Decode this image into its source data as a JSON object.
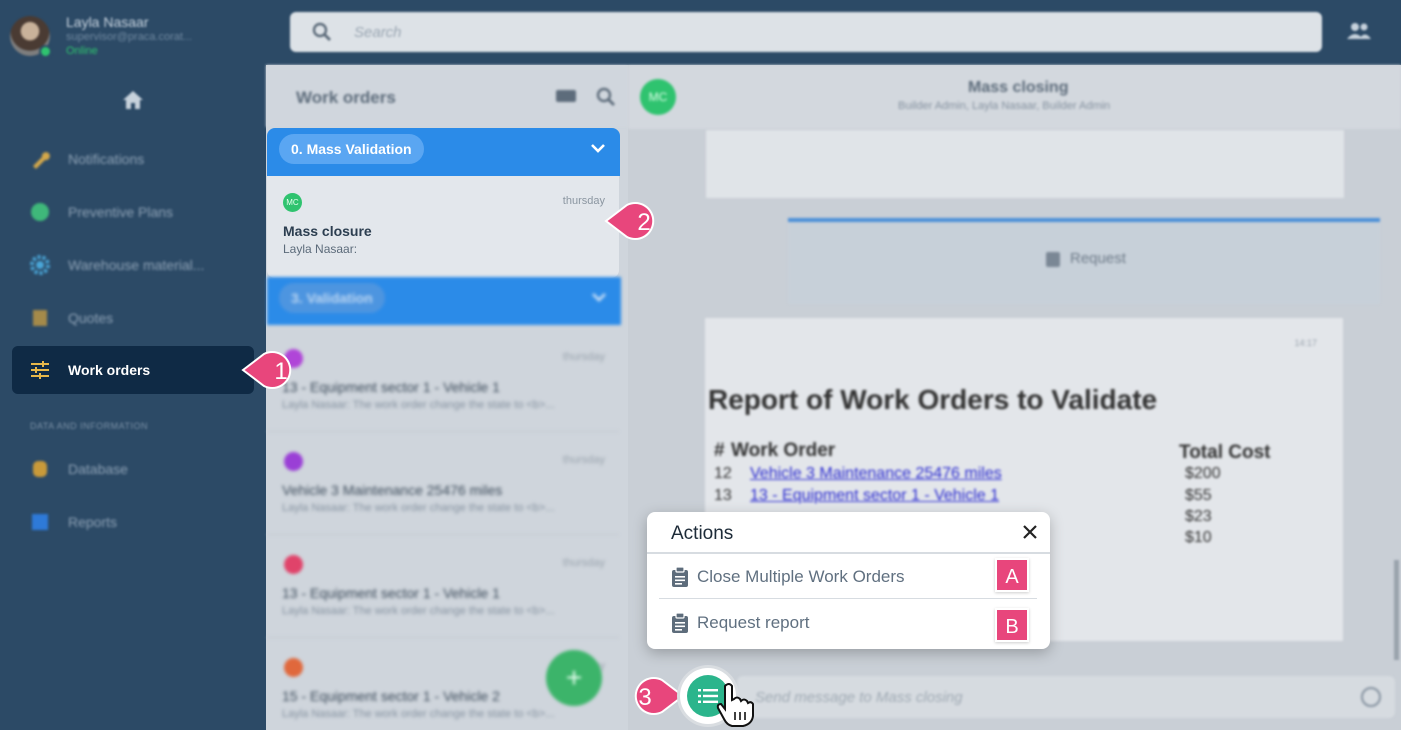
{
  "user": {
    "name": "Layla Nasaar",
    "email": "supervisor@praca.corat...",
    "status": "Online"
  },
  "search": {
    "placeholder": "Search"
  },
  "sidebar": {
    "items": [
      {
        "label": "Notifications",
        "icon": "wrench-icon"
      },
      {
        "label": "Preventive Plans",
        "icon": "globe-icon"
      },
      {
        "label": "Warehouse material...",
        "icon": "gear-icon"
      },
      {
        "label": "Quotes",
        "icon": "quotes-icon"
      },
      {
        "label": "Work orders",
        "icon": "sliders-icon",
        "active": true
      }
    ],
    "section_label": "DATA AND INFORMATION",
    "data_items": [
      {
        "label": "Database",
        "icon": "database-icon"
      },
      {
        "label": "Reports",
        "icon": "reports-icon"
      }
    ]
  },
  "list": {
    "title": "Work orders",
    "groups": [
      {
        "label": "0. Mass Validation"
      },
      {
        "label": "3. Validation"
      }
    ],
    "selected": {
      "avatar": "MC",
      "date": "thursday",
      "title": "Mass closure",
      "subtitle": "Layla Nasaar:"
    },
    "items": [
      {
        "date": "thursday",
        "title": "13 - Equipment sector 1 - Vehicle 1",
        "subtitle": "Layla Nasaar: The work order change the state to <b>...",
        "color": "#b045d8"
      },
      {
        "date": "thursday",
        "title": "Vehicle 3 Maintenance 25476 miles",
        "subtitle": "Layla Nasaar: The work order change the state to <b>...",
        "color": "#9a3fd6"
      },
      {
        "date": "thursday",
        "title": "13 - Equipment sector 1 - Vehicle 1",
        "subtitle": "Layla Nasaar: The work order change the state to <b>...",
        "color": "#e0436a"
      },
      {
        "date": "thursday",
        "title": "15 - Equipment sector 1 - Vehicle 2",
        "subtitle": "Layla Nasaar: The work order change the state to <b>...",
        "color": "#e0683c"
      }
    ]
  },
  "chat": {
    "avatar": "MC",
    "title": "Mass closing",
    "subtitle": "Builder Admin, Layla Nasaar, Builder Admin",
    "request_label": "Request",
    "input_placeholder": "Send message to Mass closing"
  },
  "report": {
    "time": "14:17",
    "title": "Report of Work Orders to Validate",
    "col_hash": "#",
    "col_order": "Work Order",
    "col_cost": "Total Cost",
    "rows": [
      {
        "num": "12",
        "name": "Vehicle 3 Maintenance 25476 miles",
        "cost": "$200"
      },
      {
        "num": "13",
        "name": "13 - Equipment sector 1 - Vehicle 1",
        "cost": "$55"
      },
      {
        "num": "",
        "name": "",
        "cost": "$23"
      },
      {
        "num": "",
        "name": "",
        "cost": "$10"
      }
    ]
  },
  "actions": {
    "title": "Actions",
    "items": [
      {
        "label": "Close Multiple Work Orders",
        "badge": "A"
      },
      {
        "label": "Request report",
        "badge": "B"
      }
    ]
  },
  "callouts": [
    "1",
    "2",
    "3"
  ],
  "colors": {
    "accent": "#2b8be8",
    "callout": "#e8467c",
    "fab": "#2bb58c",
    "sidebar": "#2c4a66"
  }
}
